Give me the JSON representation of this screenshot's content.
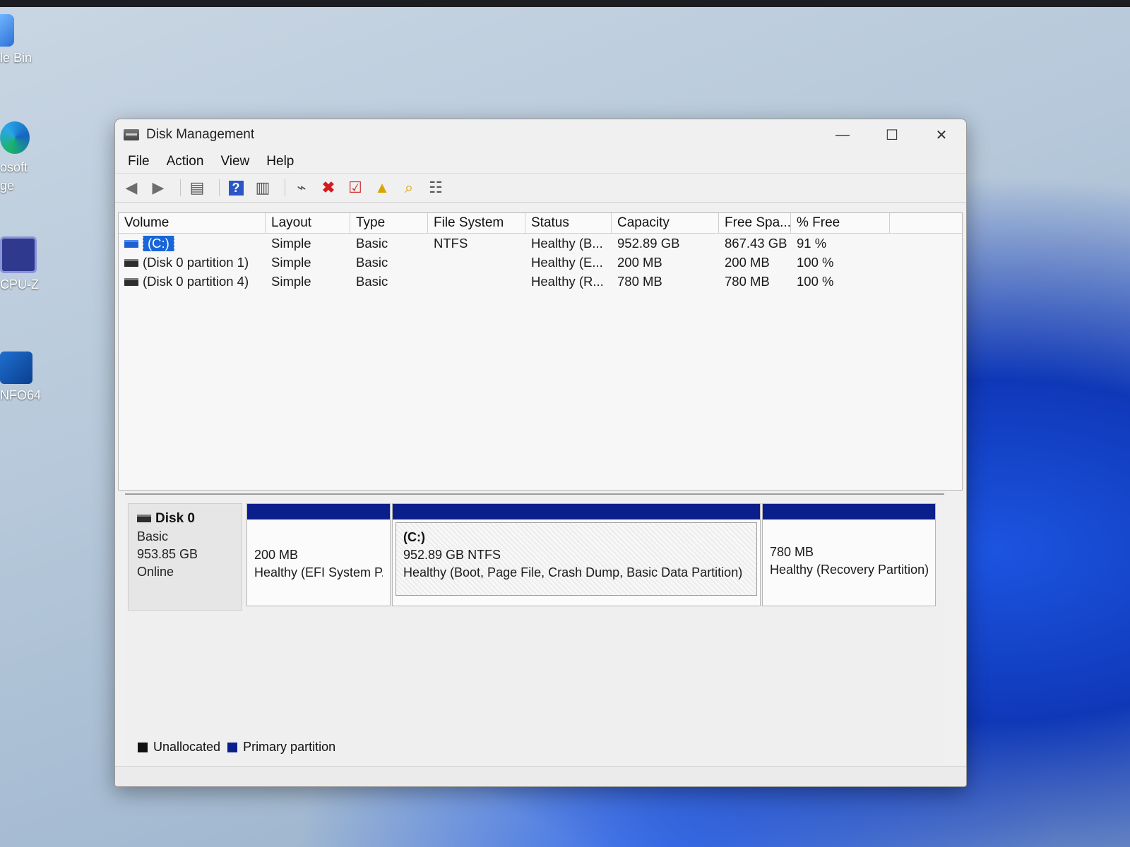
{
  "desktop": {
    "icons": [
      {
        "label": "le Bin",
        "icon": "recycle-bin-icon"
      },
      {
        "label": "osoft\nge",
        "icon": "edge-icon"
      },
      {
        "label": "CPU-Z",
        "icon": "cpuz-icon"
      },
      {
        "label": "NFO64",
        "icon": "aida64-icon"
      }
    ]
  },
  "window": {
    "title": "Disk Management",
    "controls": {
      "minimize": "—",
      "maximize": "☐",
      "close": "✕"
    }
  },
  "menu": [
    "File",
    "Action",
    "View",
    "Help"
  ],
  "toolbar": {
    "icons": [
      "back-arrow-icon",
      "forward-arrow-icon",
      "console-tree-icon",
      "help-icon",
      "properties-view-icon",
      "connect-icon",
      "delete-icon",
      "checklist-icon",
      "export-icon",
      "search-folder-icon",
      "list-view-icon"
    ]
  },
  "table": {
    "columns": [
      "Volume",
      "Layout",
      "Type",
      "File System",
      "Status",
      "Capacity",
      "Free Spa...",
      "% Free"
    ],
    "rows": [
      [
        "(C:)",
        "Simple",
        "Basic",
        "NTFS",
        "Healthy (B...",
        "952.89 GB",
        "867.43 GB",
        "91 %"
      ],
      [
        "(Disk 0 partition 1)",
        "Simple",
        "Basic",
        "",
        "Healthy (E...",
        "200 MB",
        "200 MB",
        "100 %"
      ],
      [
        "(Disk 0 partition 4)",
        "Simple",
        "Basic",
        "",
        "Healthy (R...",
        "780 MB",
        "780 MB",
        "100 %"
      ]
    ]
  },
  "disk": {
    "name": "Disk 0",
    "type": "Basic",
    "size": "953.85 GB",
    "state": "Online",
    "partitions": [
      {
        "label": "",
        "size": "200 MB",
        "status": "Healthy (EFI System P."
      },
      {
        "label": "(C:)",
        "size": "952.89 GB NTFS",
        "status": "Healthy (Boot, Page File, Crash Dump, Basic Data Partition)"
      },
      {
        "label": "",
        "size": "780 MB",
        "status": "Healthy (Recovery Partition)"
      }
    ]
  },
  "legend": {
    "unallocated": "Unallocated",
    "primary": "Primary partition",
    "colors": {
      "unallocated": "#111111",
      "primary": "#0b1f8c"
    }
  }
}
